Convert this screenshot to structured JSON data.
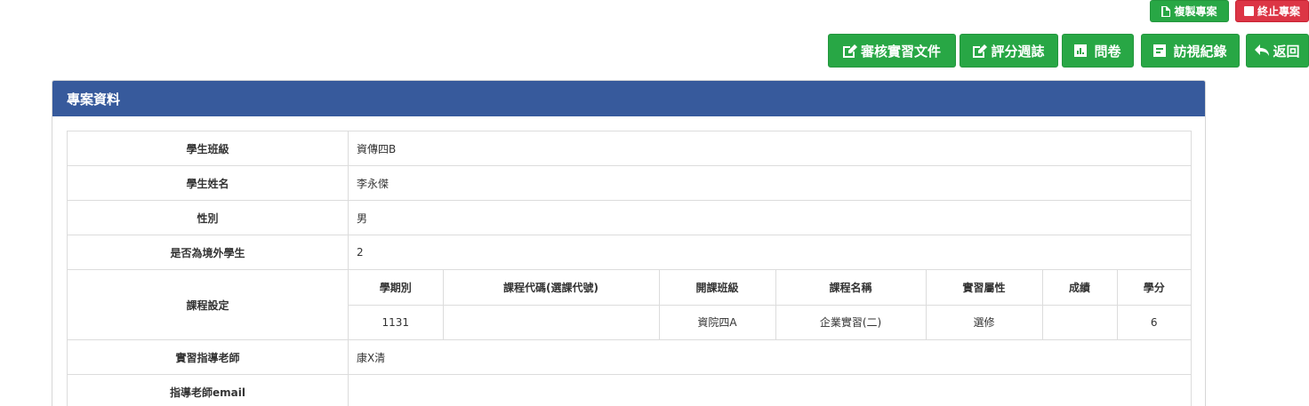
{
  "top_actions": {
    "copy_project": "複製專案",
    "end_project": "終止專案"
  },
  "toolbar": {
    "review_docs": "審核實習文件",
    "grade_weekly": "評分週誌",
    "survey": "問卷",
    "visit_records": "訪視紀錄",
    "back": "返回"
  },
  "card": {
    "title": "專案資料"
  },
  "info": {
    "class_label": "學生班級",
    "class_value": "資傳四B",
    "name_label": "學生姓名",
    "name_value": "李永傑",
    "gender_label": "性別",
    "gender_value": "男",
    "overseas_label": "是否為境外學生",
    "overseas_value": "2",
    "course_label": "課程設定",
    "teacher_label": "實習指導老師",
    "teacher_value": "康X清",
    "email_label": "指導老師email",
    "email_value": ""
  },
  "course_table": {
    "headers": [
      "學期別",
      "課程代碼(選課代號)",
      "開課班級",
      "課程名稱",
      "實習屬性",
      "成績",
      "學分"
    ],
    "rows": [
      [
        "1131",
        "",
        "資院四A",
        "企業實習(二)",
        "選修",
        "",
        "6"
      ]
    ]
  },
  "colors": {
    "header_blue": "#375a9c",
    "button_green": "#28a745",
    "button_red": "#dc3545"
  }
}
